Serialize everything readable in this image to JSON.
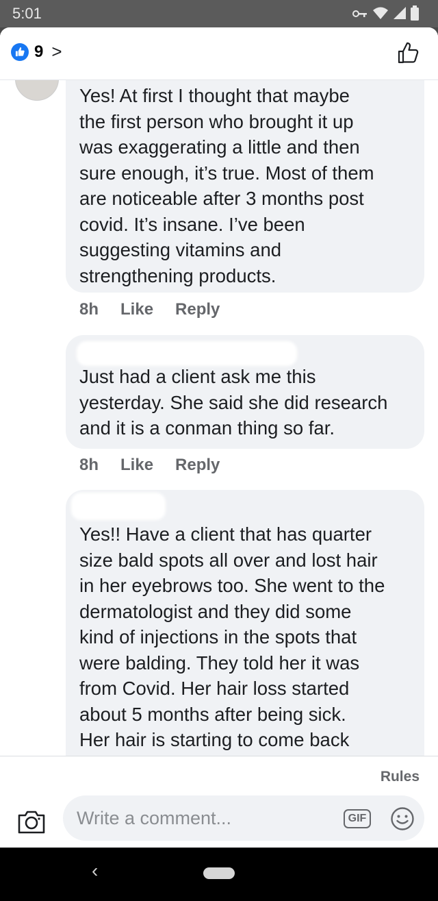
{
  "status": {
    "time": "5:01"
  },
  "header": {
    "reaction_count": "9",
    "chevron": ">"
  },
  "comments": [
    {
      "text": "Yes! At first I thought that maybe\nthe first person who brought it up\nwas exaggerating a little and then\nsure enough, it’s true. Most of them\nare noticeable after 3 months post\ncovid. It’s insane. I’ve been\nsuggesting vitamins and\nstrengthening products.",
      "time": "8h",
      "like": "Like",
      "reply": "Reply"
    },
    {
      "text": "Just had a client ask me this\nyesterday. She said she did research\nand it is a conman thing so far.",
      "time": "8h",
      "like": "Like",
      "reply": "Reply"
    },
    {
      "text": "Yes!! Have a client that has quarter\nsize bald spots all over and lost hair\nin her eyebrows too. She went to the\ndermatologist and they did some\nkind of injections in the spots that\nwere balding. They told her it was\nfrom Covid. Her hair loss started\nabout 5 months after being sick.\nHer hair is starting to come back"
    }
  ],
  "composer": {
    "rules": "Rules",
    "placeholder": "Write a comment...",
    "gif": "GIF"
  },
  "icons": {
    "like_badge": "thumbs-up-icon",
    "header_like": "thumbs-up-outline-icon",
    "camera": "camera-icon",
    "emoji": "smiley-icon",
    "back": "back-icon",
    "home": "home-pill-icon"
  },
  "colors": {
    "accent": "#1877f2",
    "bubble": "#f0f2f5",
    "muted_text": "#65676b",
    "status_bar": "#5b5b5b",
    "nav_bar": "#000000"
  }
}
